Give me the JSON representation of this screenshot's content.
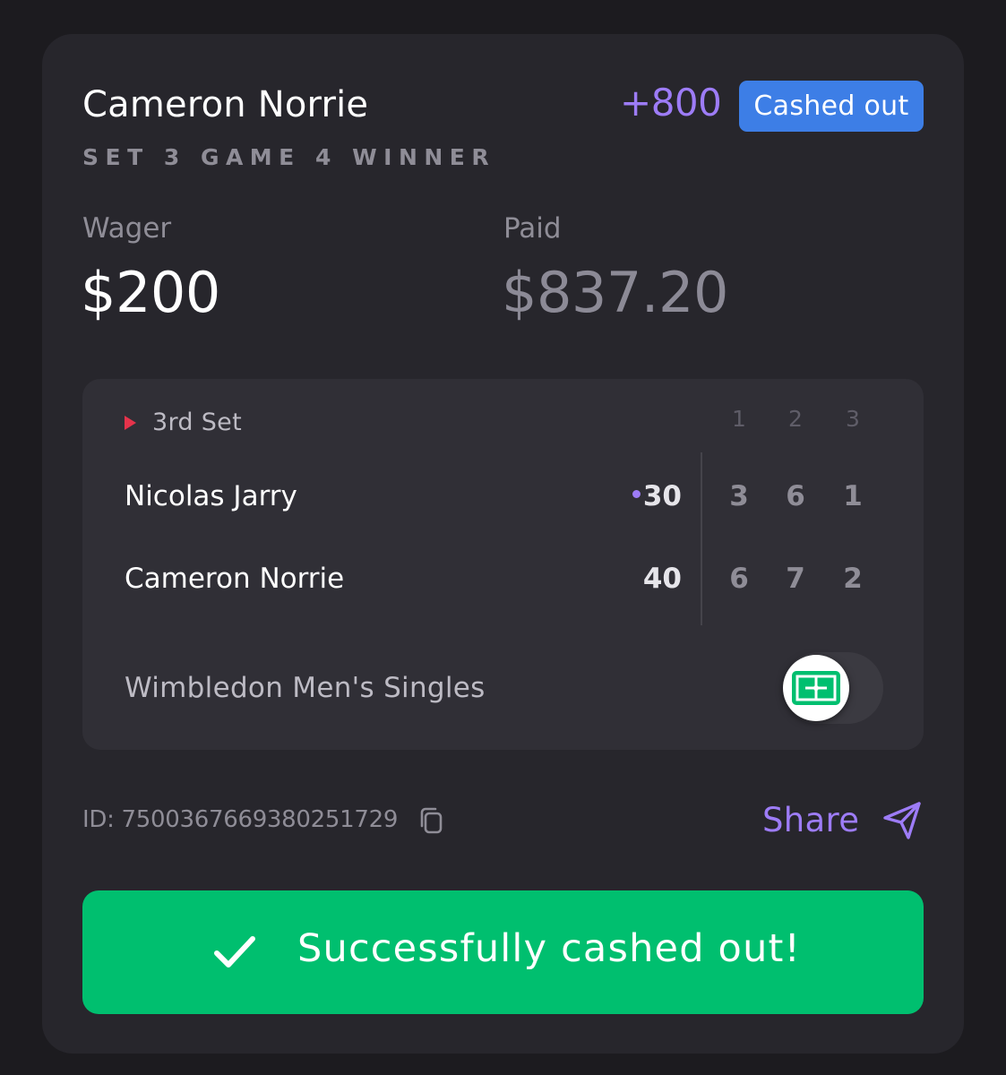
{
  "bet": {
    "selection": "Cameron Norrie",
    "odds": "+800",
    "status": "Cashed out",
    "market": "SET 3 GAME 4 WINNER",
    "wager_label": "Wager",
    "wager_amount": "$200",
    "paid_label": "Paid",
    "paid_amount": "$837.20"
  },
  "scoreboard": {
    "current_set": "3rd Set",
    "set_headers": [
      "1",
      "2",
      "3"
    ],
    "players": [
      {
        "name": "Nicolas Jarry",
        "points": "30",
        "serving": true,
        "sets": [
          "3",
          "6",
          "1"
        ]
      },
      {
        "name": "Cameron Norrie",
        "points": "40",
        "serving": false,
        "sets": [
          "6",
          "7",
          "2"
        ]
      }
    ],
    "event": "Wimbledon Men's Singles",
    "toggle_icon": "tennis-court-icon",
    "toggle_on": false
  },
  "footer": {
    "bet_id": "ID: 7500367669380251729",
    "copy_icon": "copy-icon",
    "share_label": "Share",
    "share_icon": "send-icon"
  },
  "confirmation": {
    "message": "Successfully cashed out!",
    "icon": "checkmark-icon"
  },
  "colors": {
    "background": "#1c1b1f",
    "card": "#27262c",
    "accent_purple": "#9d7cf7",
    "badge_blue": "#3d7ee6",
    "success_green": "#00bf6f",
    "live_red": "#e5334b"
  }
}
